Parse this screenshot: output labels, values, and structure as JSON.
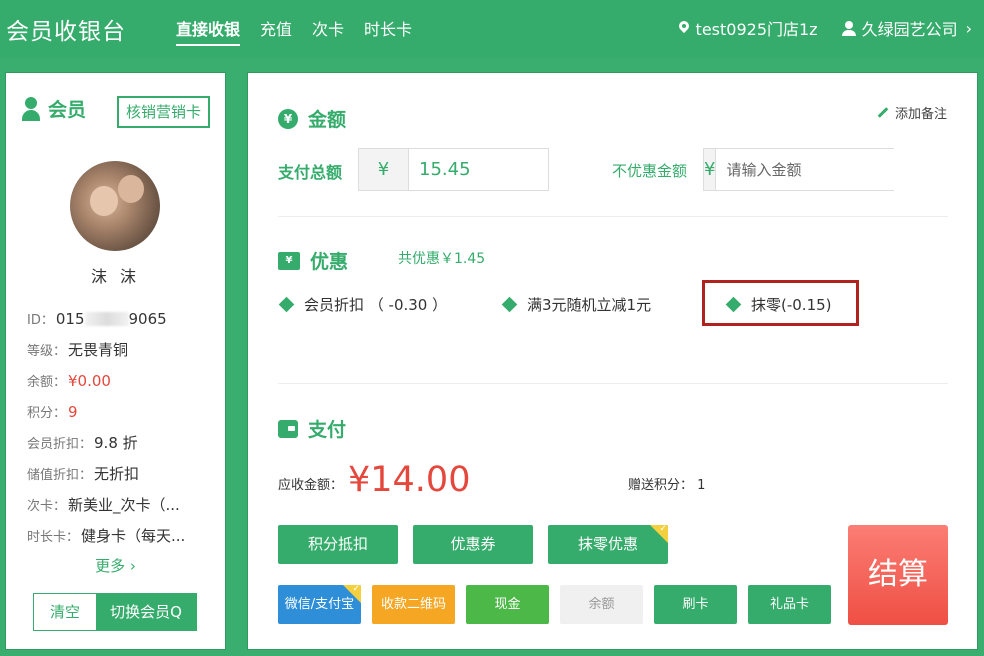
{
  "header": {
    "title": "会员收银台",
    "tabs": [
      {
        "label": "直接收银",
        "active": true
      },
      {
        "label": "充值"
      },
      {
        "label": "次卡"
      },
      {
        "label": "时长卡"
      }
    ],
    "store": "test0925门店1z",
    "company": "久绿园艺公司",
    "icons": {
      "store": "location-pin-icon",
      "company": "user-icon",
      "chevron": "chevron-right-icon"
    }
  },
  "member": {
    "heading": "会员",
    "verify_button": "核销营销卡",
    "name": "沫 沫",
    "fields": [
      {
        "label": "ID：",
        "value_prefix": "015",
        "value_suffix": "9065"
      },
      {
        "label": "等级：",
        "value": "无畏青铜"
      },
      {
        "label": "余额：",
        "value": "¥0.00",
        "color": "#e4473c"
      },
      {
        "label": "积分：",
        "value": "9",
        "color": "#e4473c"
      },
      {
        "label": "会员折扣：",
        "value": "9.8 折"
      },
      {
        "label": "储值折扣：",
        "value": "无折扣"
      },
      {
        "label": "次卡：",
        "value": "新美业_次卡（..."
      },
      {
        "label": "时长卡：",
        "value": "健身卡（每天..."
      }
    ],
    "more": "更多 ›",
    "clear_button": "清空",
    "switch_button": "切换会员Q"
  },
  "amount": {
    "heading": "金额",
    "add_note": "添加备注",
    "total_label": "支付总额",
    "currency": "¥",
    "total_value": "15.45",
    "no_discount_label": "不优惠金额",
    "no_discount_placeholder": "请输入金额"
  },
  "discount": {
    "heading": "优惠",
    "ticket_text": "¥",
    "total": "共优惠￥1.45",
    "items": [
      {
        "label": "会员折扣 （ -0.30 ）"
      },
      {
        "label": "满3元随机立减1元"
      },
      {
        "label": "抹零(-0.15)",
        "highlighted": true
      }
    ]
  },
  "payment": {
    "heading": "支付",
    "due_label": "应收金额：",
    "due_amount": "¥14.00",
    "points_label": "赠送积分： 1",
    "actions": [
      {
        "label": "积分抵扣"
      },
      {
        "label": "优惠券"
      },
      {
        "label": "抹零优惠",
        "selected": true
      }
    ],
    "methods": [
      {
        "label": "微信/支付宝",
        "color": "#2e8fd8",
        "selected": true
      },
      {
        "label": "收款二维码",
        "color": "#f5a623"
      },
      {
        "label": "现金",
        "color": "#4cb848"
      },
      {
        "label": "余额",
        "color": "#f0f0f0",
        "text_color": "#999"
      },
      {
        "label": "刷卡",
        "color": "#35ac6b"
      },
      {
        "label": "礼品卡",
        "color": "#35ac6b"
      }
    ],
    "checkout": "结算"
  },
  "colors": {
    "brand": "#35ac6b",
    "accent_red": "#e4473c",
    "highlight_border": "#b0221d"
  }
}
